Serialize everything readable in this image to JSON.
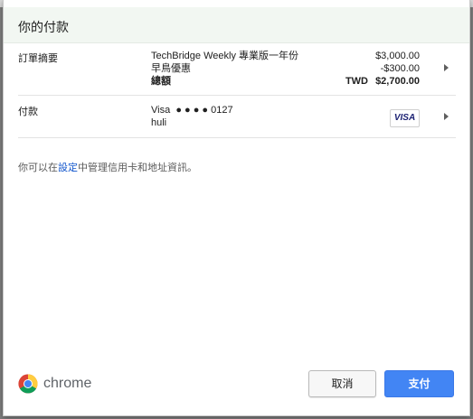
{
  "dialog": {
    "title": "你的付款"
  },
  "order_summary": {
    "label": "訂單摘要",
    "items": [
      {
        "name": "TechBridge Weekly 專業版一年份",
        "amount": "$3,000.00"
      },
      {
        "name": "早鳥優惠",
        "amount": "-$300.00"
      }
    ],
    "total": {
      "label": "總額",
      "currency": "TWD",
      "amount": "$2,700.00"
    }
  },
  "payment": {
    "label": "付款",
    "card_brand": "Visa",
    "card_masked": "● ● ● ● 0127",
    "cardholder": "huli",
    "card_badge": "VISA"
  },
  "info": {
    "prefix": "你可以在",
    "link": "設定",
    "suffix": "中管理信用卡和地址資訊。"
  },
  "footer": {
    "brand": "chrome",
    "cancel_label": "取消",
    "pay_label": "支付"
  },
  "colors": {
    "header_bg": "#f2f7f2",
    "pay_button": "#4285f4",
    "link": "#1155cc"
  }
}
